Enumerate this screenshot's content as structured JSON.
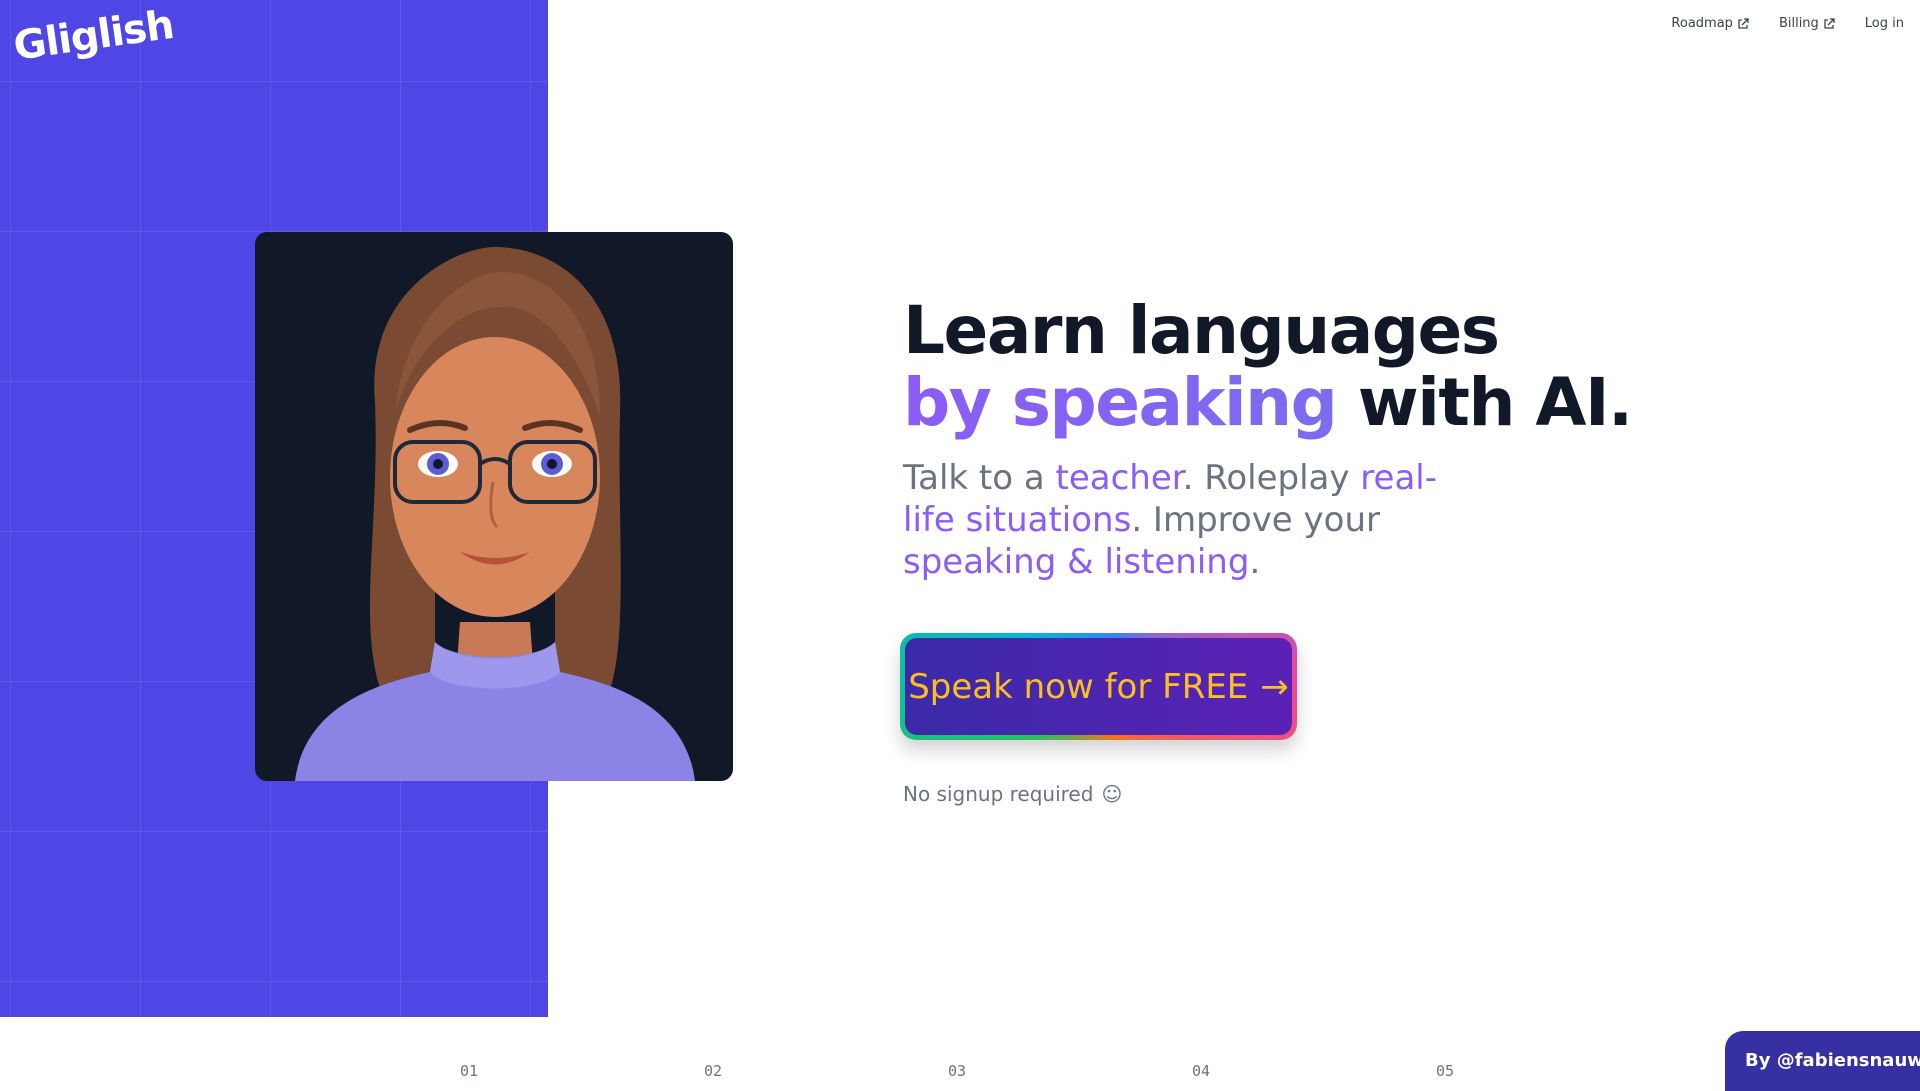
{
  "brand": {
    "logo_text": "Gliglish",
    "accent": "#4f46e5"
  },
  "nav": {
    "roadmap": "Roadmap",
    "billing": "Billing",
    "login": "Log in"
  },
  "hero": {
    "line1": "Learn languages",
    "line2_accent": "by speaking",
    "line2_rest": " with AI.",
    "sub": {
      "p1": "Talk to a ",
      "h1": "teacher",
      "p2": ". Roleplay ",
      "h2": "real-life situations",
      "p3": ". Improve your ",
      "h3": "speaking & listening",
      "p4": "."
    },
    "cta_label": "Speak now for FREE",
    "cta_arrow": "→",
    "note": "No signup required",
    "note_icon": "☺"
  },
  "steps": [
    "01",
    "02",
    "03",
    "04",
    "05"
  ],
  "credit": "By @fabiensnauwaert"
}
